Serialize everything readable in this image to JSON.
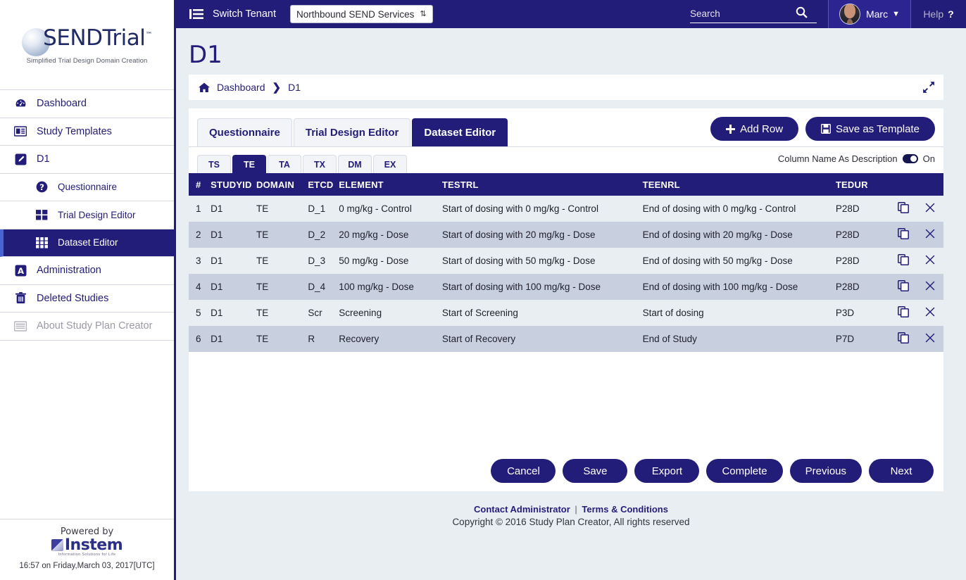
{
  "brand": {
    "logo_text": "SENDTrial",
    "logo_tm": "™",
    "tagline": "Simplified Trial Design Domain Creation"
  },
  "sidebar": {
    "items": [
      {
        "label": "Dashboard",
        "icon": "dashboard-icon",
        "level": 0,
        "active": false,
        "muted": false
      },
      {
        "label": "Study Templates",
        "icon": "newspaper-icon",
        "level": 0,
        "active": false,
        "muted": false
      },
      {
        "label": "D1",
        "icon": "pencil-square-icon",
        "level": 0,
        "active": false,
        "muted": false
      },
      {
        "label": "Questionnaire",
        "icon": "question-circle-icon",
        "level": 1,
        "active": false,
        "muted": false
      },
      {
        "label": "Trial Design Editor",
        "icon": "grid-four-icon",
        "level": 1,
        "active": false,
        "muted": false
      },
      {
        "label": "Dataset Editor",
        "icon": "grid-nine-icon",
        "level": 1,
        "active": true,
        "muted": false
      },
      {
        "label": "Administration",
        "icon": "letter-a-icon",
        "level": 0,
        "active": false,
        "muted": false
      },
      {
        "label": "Deleted Studies",
        "icon": "trash-icon",
        "level": 0,
        "active": false,
        "muted": false
      },
      {
        "label": "About Study Plan Creator",
        "icon": "about-icon",
        "level": 0,
        "active": false,
        "muted": true
      }
    ],
    "footer": {
      "powered_by": "Powered by",
      "company": "Instem",
      "company_tagline": "Information Solutions for Life",
      "timestamp": "16:57 on Friday,March 03, 2017[UTC]"
    }
  },
  "topbar": {
    "switch_tenant_label": "Switch Tenant",
    "switch_tenant_icon": "list-indent-icon",
    "tenant_selected": "Northbound SEND Services",
    "tenant_caret_icon": "updown-caret-icon",
    "search_placeholder": "Search",
    "search_value": "",
    "search_icon": "search-icon",
    "user_name": "Marc",
    "user_caret_icon": "chevron-down-icon",
    "help_label": "Help",
    "help_glyph": "?"
  },
  "page": {
    "title": "D1",
    "breadcrumb": {
      "home_icon": "home-icon",
      "items": [
        "Dashboard",
        "D1"
      ],
      "separator": "❯",
      "expand_icon": "expand-arrows-icon"
    }
  },
  "main": {
    "tabs": [
      {
        "label": "Questionnaire",
        "active": false
      },
      {
        "label": "Trial Design Editor",
        "active": false
      },
      {
        "label": "Dataset Editor",
        "active": true
      }
    ],
    "actions": {
      "add_row": "Add Row",
      "add_row_icon": "plus-icon",
      "save_as_template": "Save as Template",
      "save_as_template_icon": "floppy-disk-icon"
    },
    "subtabs": [
      {
        "label": "TS",
        "active": false
      },
      {
        "label": "TE",
        "active": true
      },
      {
        "label": "TA",
        "active": false
      },
      {
        "label": "TX",
        "active": false
      },
      {
        "label": "DM",
        "active": false
      },
      {
        "label": "EX",
        "active": false
      }
    ],
    "column_name_as_description": {
      "label": "Column Name As Description",
      "toggle_icon": "toggle-on-icon",
      "state": "On"
    },
    "table": {
      "columns": [
        "#",
        "STUDYID",
        "DOMAIN",
        "ETCD",
        "ELEMENT",
        "TESTRL",
        "TEENRL",
        "TEDUR"
      ],
      "row_icons": {
        "copy": "copy-icon",
        "delete": "close-x-icon"
      },
      "rows": [
        {
          "num": "1",
          "studyid": "D1",
          "domain": "TE",
          "etcd": "D_1",
          "element": "0 mg/kg - Control",
          "testrl": "Start of dosing with 0 mg/kg - Control",
          "teenrl": "End of dosing with 0 mg/kg - Control",
          "tedur": "P28D"
        },
        {
          "num": "2",
          "studyid": "D1",
          "domain": "TE",
          "etcd": "D_2",
          "element": "20 mg/kg - Dose",
          "testrl": "Start of dosing with 20 mg/kg - Dose",
          "teenrl": "End of dosing with 20 mg/kg - Dose",
          "tedur": "P28D"
        },
        {
          "num": "3",
          "studyid": "D1",
          "domain": "TE",
          "etcd": "D_3",
          "element": "50 mg/kg - Dose",
          "testrl": "Start of dosing with 50 mg/kg - Dose",
          "teenrl": "End of dosing with 50 mg/kg - Dose",
          "tedur": "P28D"
        },
        {
          "num": "4",
          "studyid": "D1",
          "domain": "TE",
          "etcd": "D_4",
          "element": "100 mg/kg - Dose",
          "testrl": "Start of dosing with 100 mg/kg - Dose",
          "teenrl": "End of dosing with 100 mg/kg - Dose",
          "tedur": "P28D"
        },
        {
          "num": "5",
          "studyid": "D1",
          "domain": "TE",
          "etcd": "Scr",
          "element": "Screening",
          "testrl": "Start of Screening",
          "teenrl": "Start of dosing",
          "tedur": "P3D"
        },
        {
          "num": "6",
          "studyid": "D1",
          "domain": "TE",
          "etcd": "R",
          "element": "Recovery",
          "testrl": "Start of Recovery",
          "teenrl": "End of Study",
          "tedur": "P7D"
        }
      ]
    },
    "bottom_buttons": [
      "Cancel",
      "Save",
      "Export",
      "Complete",
      "Previous",
      "Next"
    ]
  },
  "footer": {
    "contact": "Contact Administrator",
    "separator": "|",
    "terms": "Terms & Conditions",
    "copyright": "Copyright © 2016 Study Plan Creator, All rights reserved"
  },
  "colors": {
    "brand_purple": "#231d7a",
    "page_bg": "#e9eef3",
    "row_odd": "#e9eef3",
    "row_even": "#c8cfdf",
    "active_rail": "#4a63d0"
  }
}
